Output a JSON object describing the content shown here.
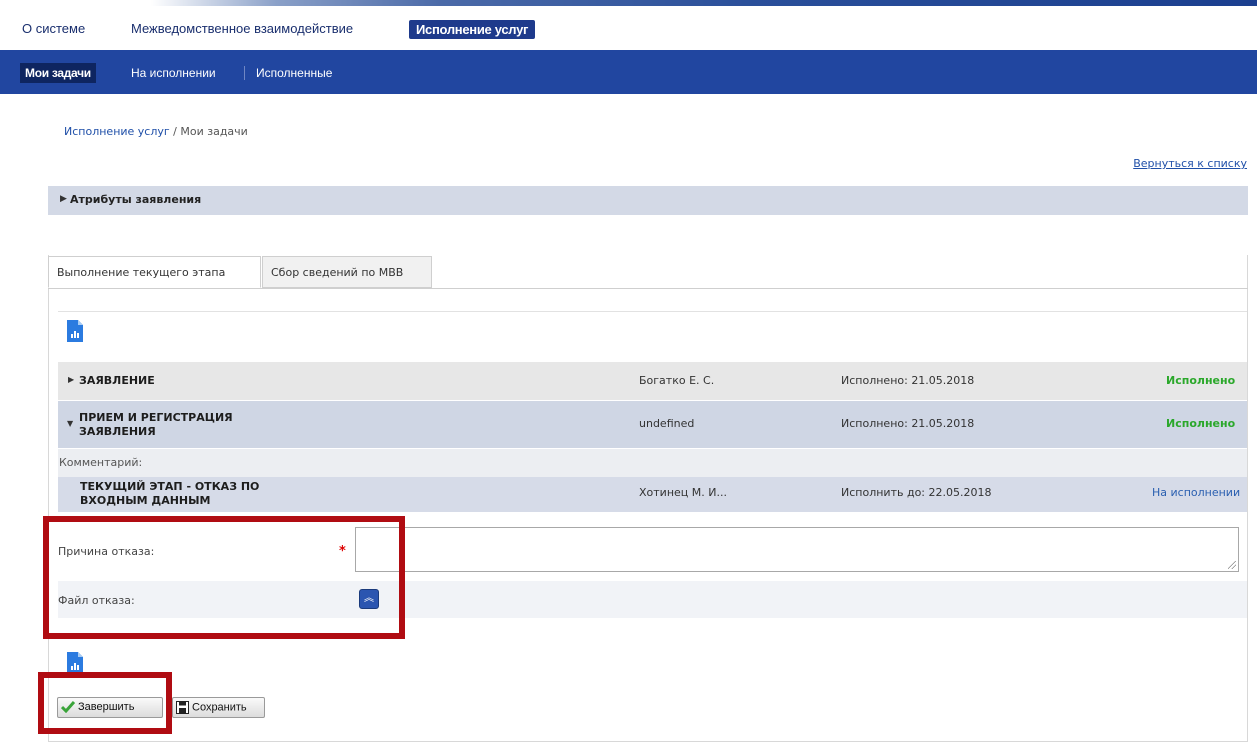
{
  "top_menu": {
    "about": "О системе",
    "interagency": "Межведомственное взаимодействие",
    "services": "Исполнение услуг"
  },
  "sub_menu": {
    "my_tasks": "Мои задачи",
    "in_progress": "На исполнении",
    "completed": "Исполненные"
  },
  "breadcrumb": {
    "root": "Исполнение услуг",
    "sep": " / ",
    "current": "Мои задачи"
  },
  "back_link": "Вернуться к списку",
  "attributes_label": "Атрибуты заявления",
  "tabs": {
    "current_stage": "Выполнение текущего этапа",
    "mvv": "Сбор сведений по МВВ"
  },
  "stages": [
    {
      "title": "ЗАЯВЛЕНИЕ",
      "executor": "Богатко Е. С.",
      "date": "Исполнено: 21.05.2018",
      "status": "Исполнено"
    },
    {
      "title_line1": "ПРИЕМ И РЕГИСТРАЦИЯ",
      "title_line2": "ЗАЯВЛЕНИЯ",
      "executor": "undefined",
      "date": "Исполнено: 21.05.2018",
      "status": "Исполнено"
    }
  ],
  "comment_label": "Комментарий:",
  "current_stage": {
    "title_line1": "ТЕКУЩИЙ ЭТАП - ОТКАЗ ПО",
    "title_line2": "ВХОДНЫМ ДАННЫМ",
    "executor": "Хотинец М. И...",
    "date": "Исполнить до: 22.05.2018",
    "status": "На исполнении"
  },
  "form": {
    "reason_label": "Причина отказа:",
    "required_mark": "*",
    "reason_value": "",
    "file_label": "Файл отказа:"
  },
  "buttons": {
    "finish": "Завершить",
    "save": "Сохранить"
  },
  "colors": {
    "nav_blue": "#2146a0",
    "done_green": "#2ba82b",
    "highlight_red": "#b00c12"
  },
  "icons": [
    "caret-right-icon",
    "caret-down-icon",
    "report-doc-icon",
    "upload-chevron-icon",
    "checkmark-icon",
    "floppy-disk-icon"
  ]
}
